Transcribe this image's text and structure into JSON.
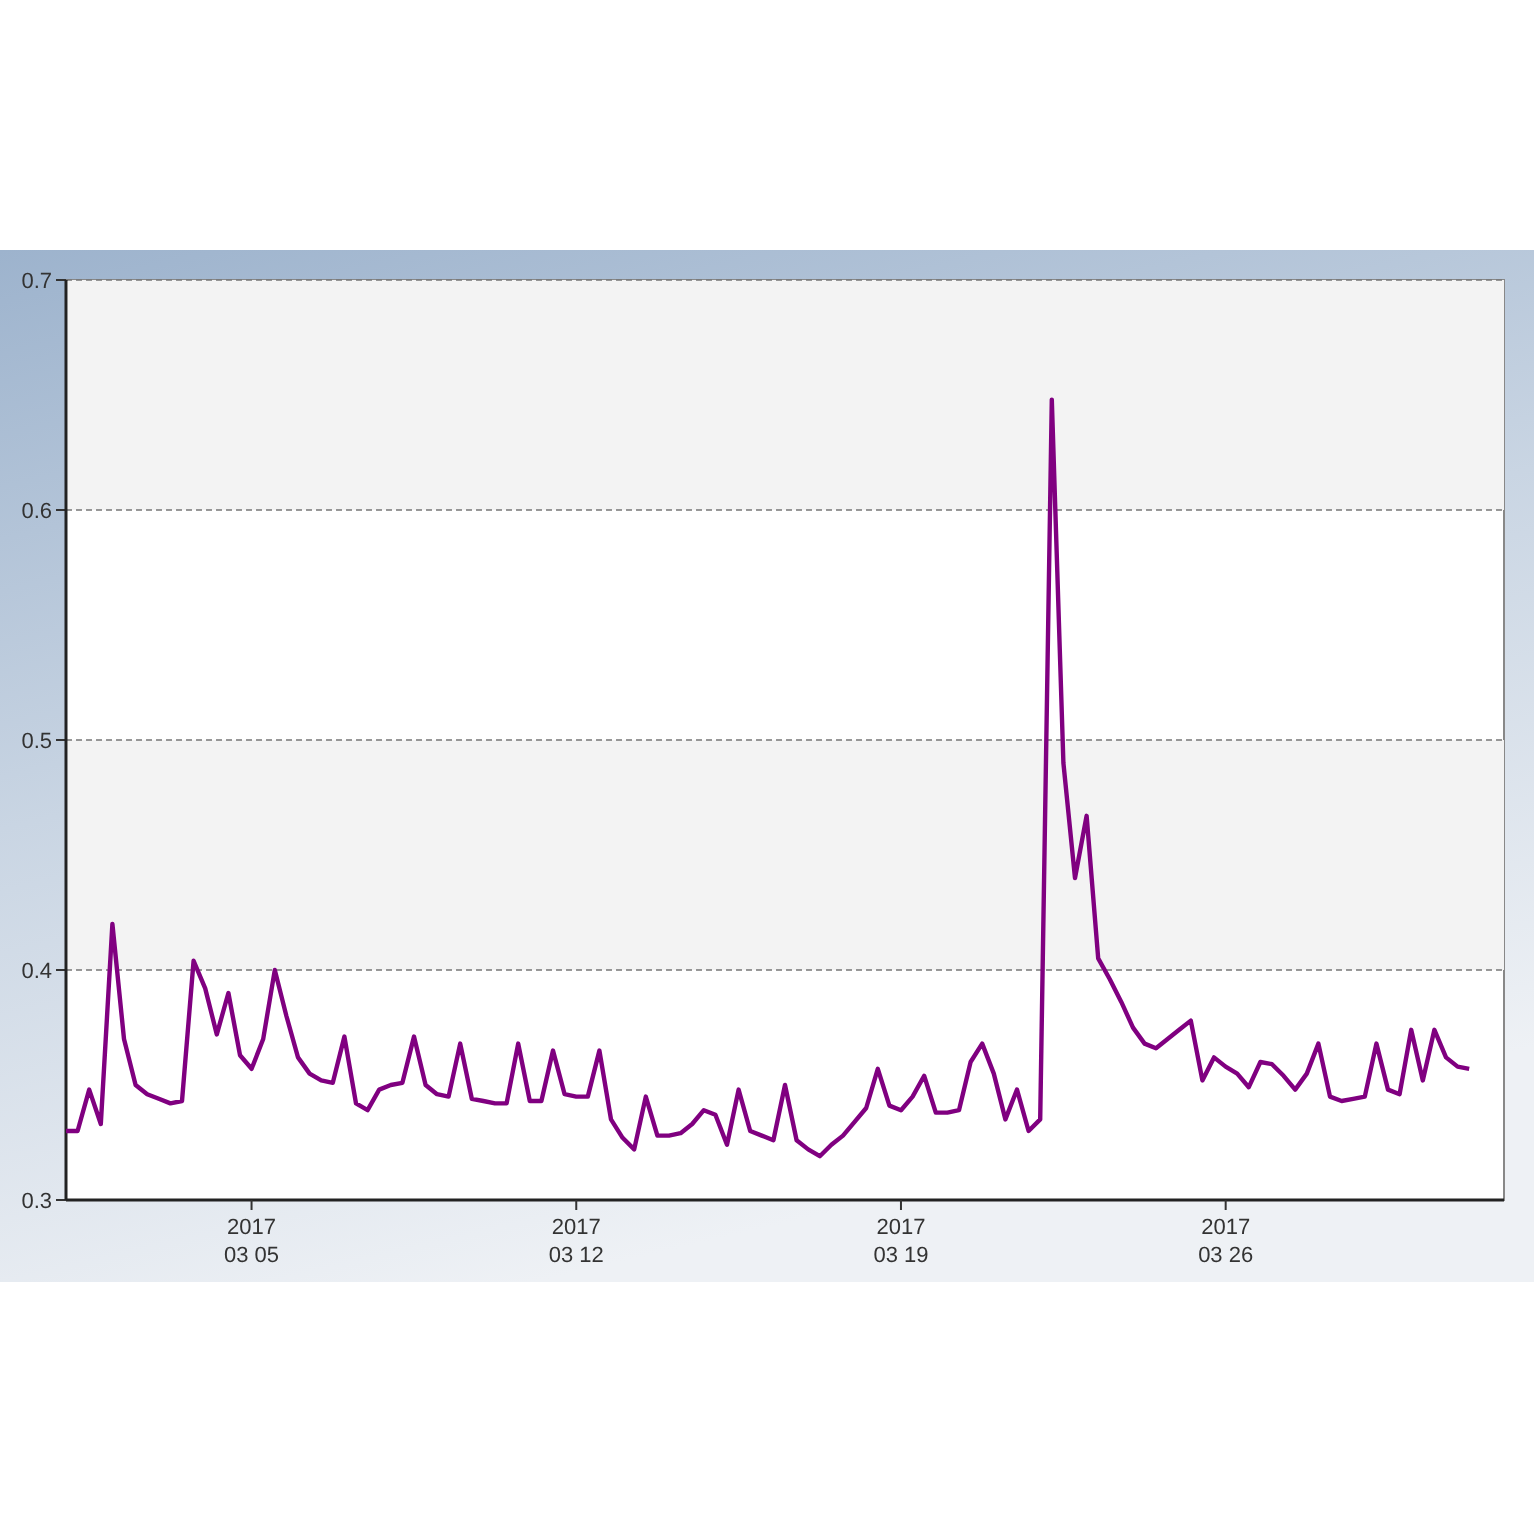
{
  "chart": {
    "chart_data": {
      "type": "line",
      "categories": [
        null,
        null,
        null,
        null,
        null,
        null,
        null,
        null,
        null,
        null,
        null,
        null,
        null,
        null,
        null,
        null,
        "2017\n03 05",
        null,
        null,
        null,
        null,
        null,
        null,
        null,
        null,
        null,
        null,
        null,
        null,
        null,
        null,
        null,
        null,
        null,
        null,
        null,
        null,
        null,
        null,
        null,
        null,
        null,
        null,
        null,
        "2017\n03 12",
        null,
        null,
        null,
        null,
        null,
        null,
        null,
        null,
        null,
        null,
        null,
        null,
        null,
        null,
        null,
        null,
        null,
        null,
        null,
        null,
        null,
        null,
        null,
        null,
        null,
        null,
        null,
        "2017\n03 19",
        null,
        null,
        null,
        null,
        null,
        null,
        null,
        null,
        null,
        null,
        null,
        null,
        null,
        null,
        null,
        null,
        null,
        null,
        null,
        null,
        null,
        null,
        null,
        null,
        null,
        null,
        null,
        "2017\n03 26",
        null,
        null,
        null,
        null,
        null,
        null,
        null,
        null,
        null,
        null,
        null,
        null,
        null,
        null,
        null,
        null,
        null,
        null,
        null,
        null,
        null
      ],
      "series": [
        {
          "color": "#800080",
          "values": [
            0.33,
            0.33,
            0.348,
            0.333,
            0.42,
            0.37,
            0.35,
            0.346,
            0.344,
            0.342,
            0.343,
            0.404,
            0.392,
            0.372,
            0.39,
            0.363,
            0.357,
            0.37,
            0.4,
            0.38,
            0.362,
            0.355,
            0.352,
            0.351,
            0.371,
            0.342,
            0.339,
            0.348,
            0.35,
            0.351,
            0.371,
            0.35,
            0.346,
            0.345,
            0.368,
            0.344,
            0.343,
            0.342,
            0.342,
            0.368,
            0.343,
            0.343,
            0.365,
            0.346,
            0.345,
            0.345,
            0.365,
            0.335,
            0.327,
            0.322,
            0.345,
            0.328,
            0.328,
            0.329,
            0.333,
            0.339,
            0.337,
            0.324,
            0.348,
            0.33,
            0.328,
            0.326,
            0.35,
            0.326,
            0.322,
            0.319,
            0.324,
            0.328,
            0.334,
            0.34,
            0.357,
            0.341,
            0.339,
            0.345,
            0.354,
            0.338,
            0.338,
            0.339,
            0.36,
            0.368,
            0.355,
            0.335,
            0.348,
            0.33,
            0.335,
            0.648,
            0.49,
            0.44,
            0.467,
            0.405,
            0.396,
            0.386,
            0.375,
            0.368,
            0.366,
            0.37,
            0.374,
            0.378,
            0.352,
            0.362,
            0.358,
            0.355,
            0.349,
            0.36,
            0.359,
            0.354,
            0.348,
            0.355,
            0.368,
            0.345,
            0.343,
            0.344,
            0.345,
            0.368,
            0.348,
            0.346,
            0.374,
            0.352,
            0.374,
            0.362,
            0.358,
            0.357
          ]
        }
      ],
      "grid": true,
      "bands": [
        {
          "axis": "y",
          "from": 0.4,
          "to": 0.5
        },
        {
          "axis": "y",
          "from": 0.6,
          "to": 0.7
        }
      ],
      "ylim": [
        0.3,
        0.7
      ],
      "yticks": [
        {
          "value": 0.3,
          "label": "0.3"
        },
        {
          "value": 0.4,
          "label": "0.4"
        },
        {
          "value": 0.5,
          "label": "0.5"
        },
        {
          "value": 0.6,
          "label": "0.6"
        },
        {
          "value": 0.7,
          "label": "0.7"
        }
      ]
    }
  }
}
